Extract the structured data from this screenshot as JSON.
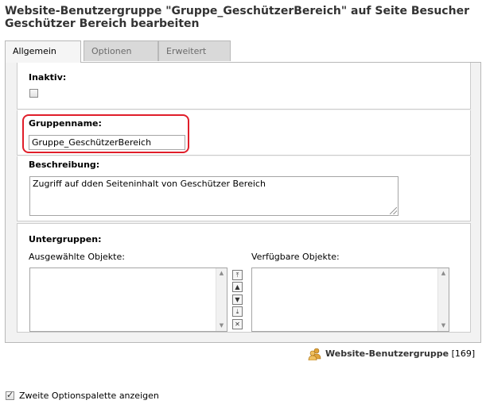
{
  "page": {
    "title": "Website-Benutzergruppe \"Gruppe_GeschützerBereich\" auf Seite Besucher Geschützer Bereich bearbeiten"
  },
  "tabs": [
    {
      "label": "Allgemein",
      "active": true
    },
    {
      "label": "Optionen",
      "active": false
    },
    {
      "label": "Erweitert",
      "active": false
    }
  ],
  "form": {
    "inaktiv": {
      "label": "Inaktiv:",
      "checked": false
    },
    "gruppenname": {
      "label": "Gruppenname:",
      "value": "Gruppe_GeschützerBereich"
    },
    "beschreibung": {
      "label": "Beschreibung:",
      "value": "Zugriff auf dden Seiteninhalt von Geschützer Bereich"
    },
    "untergruppen": {
      "label": "Untergruppen:",
      "selected_label": "Ausgewählte Objekte:",
      "available_label": "Verfügbare Objekte:",
      "selected_items": [],
      "available_items": []
    }
  },
  "record": {
    "type_label": "Website-Benutzergruppe",
    "id": "[169]",
    "icon": "user-group-icon"
  },
  "options": {
    "second_palette_label": "Zweite Optionspalette anzeigen",
    "checked": true
  },
  "colors": {
    "highlight": "#e01e2a",
    "panel_bg": "#f2f2f2",
    "tab_inactive": "#d9d9d9"
  }
}
